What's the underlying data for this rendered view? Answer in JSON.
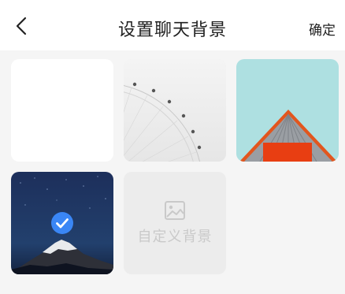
{
  "header": {
    "back_icon": "chevron-left-icon",
    "title": "设置聊天背景",
    "confirm_label": "确定"
  },
  "backgrounds": [
    {
      "id": "plain-white",
      "selected": false
    },
    {
      "id": "ferris-wheel",
      "selected": false
    },
    {
      "id": "red-roof",
      "selected": false
    },
    {
      "id": "night-mountain",
      "selected": true
    },
    {
      "id": "custom",
      "label": "自定义背景",
      "icon": "image-icon",
      "selected": false
    }
  ],
  "colors": {
    "accent": "#3a86f5",
    "page_bg": "#f5f5f5",
    "custom_tile_bg": "#ececec",
    "custom_text": "#c9c9c9"
  }
}
